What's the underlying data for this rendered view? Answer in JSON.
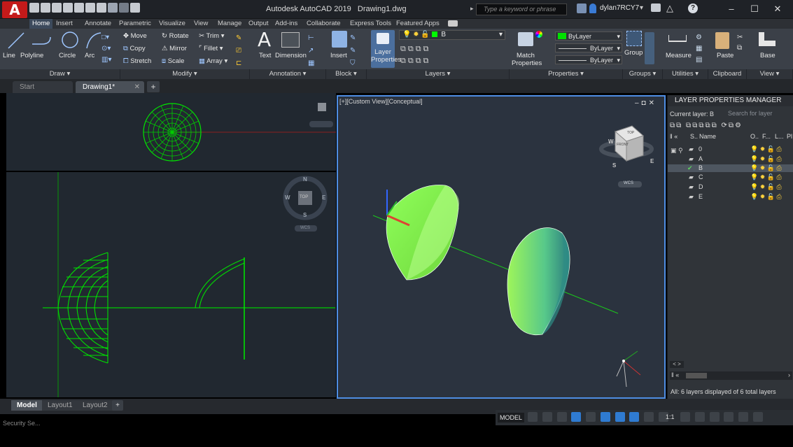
{
  "app": {
    "title": "Autodesk AutoCAD 2019",
    "document": "Drawing1.dwg",
    "app_button": "A"
  },
  "search": {
    "placeholder": "Type a keyword or phrase"
  },
  "user": {
    "name": "dylan7RCY7"
  },
  "window_controls": {
    "minimize": "–",
    "maximize": "☐",
    "close": "✕"
  },
  "ribbon_tabs": [
    "Home",
    "Insert",
    "Annotate",
    "Parametric",
    "Visualize",
    "View",
    "Manage",
    "Output",
    "Add-ins",
    "Collaborate",
    "Express Tools",
    "Featured Apps"
  ],
  "draw": {
    "line": "Line",
    "polyline": "Polyline",
    "circle": "Circle",
    "arc": "Arc",
    "panel": "Draw ▾"
  },
  "modify": {
    "move": "Move",
    "rotate": "Rotate",
    "trim": "Trim",
    "copy": "Copy",
    "mirror": "Mirror",
    "fillet": "Fillet",
    "stretch": "Stretch",
    "scale": "Scale",
    "array": "Array",
    "panel": "Modify ▾"
  },
  "annotation": {
    "text": "Text",
    "dimension": "Dimension",
    "panel": "Annotation ▾"
  },
  "block": {
    "insert": "Insert",
    "panel": "Block ▾"
  },
  "layers": {
    "layer_properties_1": "Layer",
    "layer_properties_2": "Properties",
    "current": "B",
    "panel": "Layers ▾"
  },
  "properties": {
    "match_1": "Match",
    "match_2": "Properties",
    "color": "ByLayer",
    "linetype": "ByLayer",
    "lineweight": "ByLayer",
    "panel": "Properties ▾"
  },
  "groups": {
    "group": "Group",
    "panel": "Groups ▾"
  },
  "utilities": {
    "measure": "Measure",
    "panel": "Utilities ▾"
  },
  "clipboard": {
    "paste": "Paste",
    "panel": "Clipboard"
  },
  "view": {
    "base": "Base",
    "panel": "View ▾"
  },
  "file_tabs": {
    "start": "Start",
    "drawing": "Drawing1*",
    "add": "+"
  },
  "viewport_3d": {
    "label": "[+][Custom View][Conceptual]",
    "viewcube_top": "TOP",
    "viewcube_front": "FRONT",
    "wcs": "WCS",
    "compass_w": "W",
    "compass_s": "S",
    "compass_e": "E"
  },
  "viewport_front": {
    "compass_n": "N",
    "compass_w": "W",
    "compass_e": "E",
    "compass_s": "S",
    "cube": "TOP",
    "wcs": "WCS"
  },
  "lpm": {
    "title": "LAYER PROPERTIES MANAGER",
    "current_layer": "Current layer: B",
    "search_placeholder": "Search for layer",
    "col_status": "S..",
    "col_name": "Name",
    "col_on": "O..",
    "col_freeze": "F...",
    "col_lock": "L...",
    "col_plot": "Pl",
    "layers": [
      {
        "name": "0",
        "selected": false
      },
      {
        "name": "A",
        "selected": false
      },
      {
        "name": "B",
        "selected": true
      },
      {
        "name": "C",
        "selected": false
      },
      {
        "name": "D",
        "selected": false
      },
      {
        "name": "E",
        "selected": false
      }
    ],
    "footer": "All: 6 layers displayed of 6 total layers"
  },
  "layout_tabs": [
    "Model",
    "Layout1",
    "Layout2"
  ],
  "status": {
    "model": "MODEL",
    "scale": "1:1"
  },
  "command_text": "Security Se..."
}
